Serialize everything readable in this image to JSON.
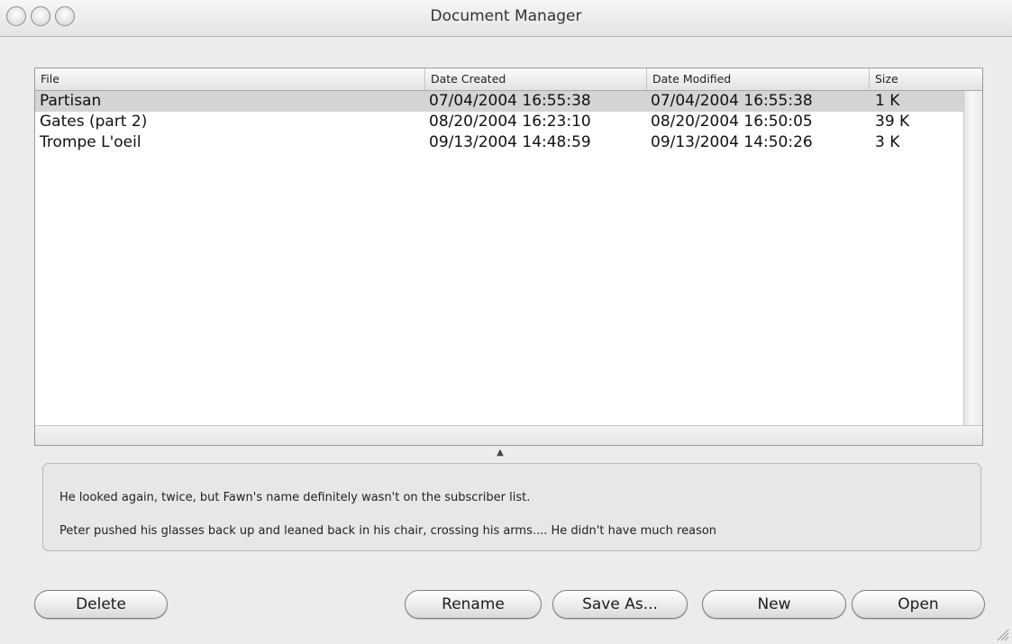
{
  "window": {
    "title": "Document Manager"
  },
  "table": {
    "columns": {
      "file": "File",
      "date_created": "Date Created",
      "date_modified": "Date Modified",
      "size": "Size"
    },
    "rows": [
      {
        "file": "Partisan",
        "date_created": "07/04/2004 16:55:38",
        "date_modified": "07/04/2004 16:55:38",
        "size": "1 K",
        "selected": true
      },
      {
        "file": "Gates (part 2)",
        "date_created": "08/20/2004 16:23:10",
        "date_modified": "08/20/2004 16:50:05",
        "size": "39 K",
        "selected": false
      },
      {
        "file": "Trompe L'oeil",
        "date_created": "09/13/2004 14:48:59",
        "date_modified": "09/13/2004 14:50:26",
        "size": "3 K",
        "selected": false
      }
    ]
  },
  "preview": {
    "line1": "He looked again, twice, but Fawn's name definitely wasn't on the subscriber list.",
    "line2": "Peter pushed his glasses back up and leaned back in his chair, crossing his arms.... He didn't have much reason"
  },
  "buttons": {
    "delete": "Delete",
    "rename": "Rename",
    "save_as": "Save As...",
    "new": "New",
    "open": "Open"
  },
  "colors": {
    "selection": "#d4d4d4",
    "window_bg": "#ececec"
  }
}
